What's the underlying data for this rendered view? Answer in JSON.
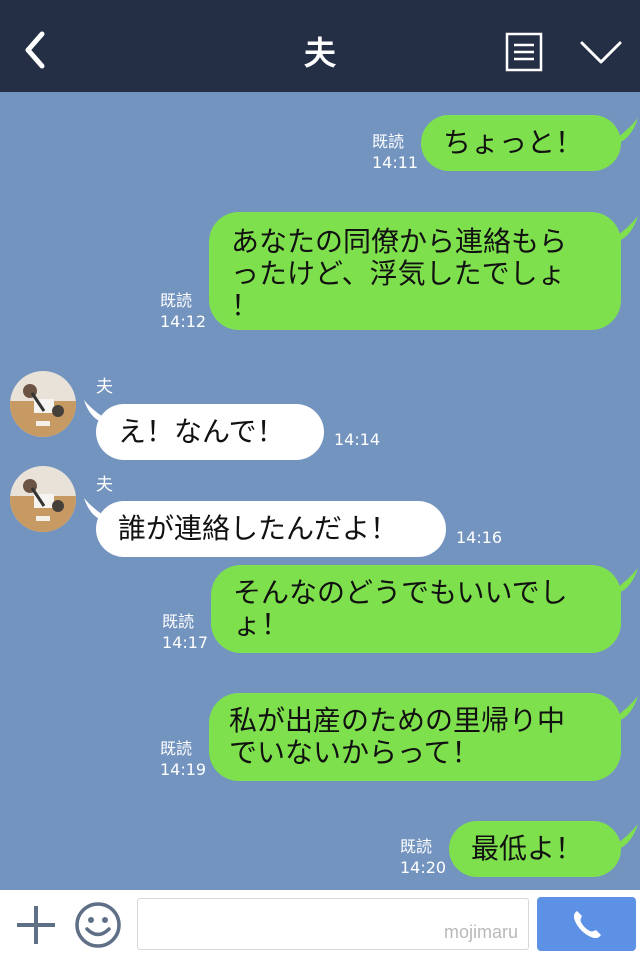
{
  "header": {
    "title": "夫"
  },
  "messages": [
    {
      "direction": "out",
      "text_lines": [
        "ちょっと！"
      ],
      "read": "既読",
      "time": "14:11"
    },
    {
      "direction": "out",
      "text_lines": [
        "あなたの同僚から連絡もら",
        "ったけど、浮気したでしょ",
        "！"
      ],
      "read": "既読",
      "time": "14:12"
    },
    {
      "direction": "in",
      "sender": "夫",
      "text_lines": [
        "え！なんで！"
      ],
      "time": "14:14"
    },
    {
      "direction": "in",
      "sender": "夫",
      "text_lines": [
        "誰が連絡したんだよ！"
      ],
      "time": "14:16"
    },
    {
      "direction": "out",
      "text_lines": [
        "そんなのどうでもいいでし",
        "ょ！"
      ],
      "read": "既読",
      "time": "14:17"
    },
    {
      "direction": "out",
      "text_lines": [
        "私が出産のための里帰り中",
        "でいないからって！"
      ],
      "read": "既読",
      "time": "14:19"
    },
    {
      "direction": "out",
      "text_lines": [
        "最低よ！"
      ],
      "read": "既読",
      "time": "14:20"
    }
  ],
  "composer": {
    "watermark": "mojimaru"
  },
  "colors": {
    "header_bg": "#242f45",
    "chat_bg": "#7494c0",
    "outgoing_bubble": "#7fe04d",
    "incoming_bubble": "#ffffff",
    "call_button": "#5c91e6"
  },
  "icons": {
    "back": "chevron-left-icon",
    "menu": "menu-lines-icon",
    "collapse": "chevron-down-icon",
    "add": "plus-icon",
    "emoji": "smile-icon",
    "call": "phone-icon"
  }
}
